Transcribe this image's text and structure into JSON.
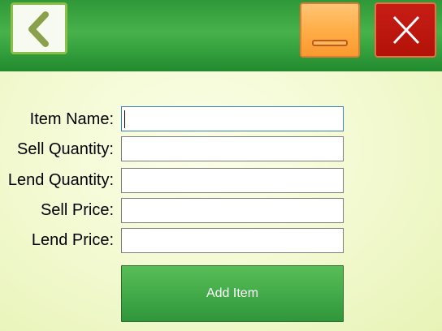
{
  "header": {
    "back_icon": "chevron-left-icon",
    "minimize_icon": "minimize-icon",
    "close_icon": "close-icon"
  },
  "form": {
    "item_name": {
      "label": "Item Name:",
      "value": ""
    },
    "sell_quantity": {
      "label": "Sell Quantity:",
      "value": ""
    },
    "lend_quantity": {
      "label": "Lend Quantity:",
      "value": ""
    },
    "sell_price": {
      "label": "Sell Price:",
      "value": ""
    },
    "lend_price": {
      "label": "Lend Price:",
      "value": ""
    },
    "submit_label": "Add Item"
  },
  "colors": {
    "header_green": "#3ca843",
    "background": "#f2f9cf",
    "minimize_orange": "#ffae47",
    "close_red": "#c0170f",
    "button_green": "#45ad4a"
  }
}
